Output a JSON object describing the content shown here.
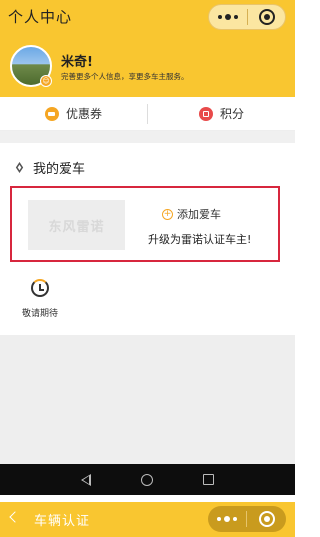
{
  "header": {
    "title": "个人中心",
    "background_color": "#F9C630",
    "menu_icon": "more-dots-icon",
    "close_icon": "target-close-icon"
  },
  "profile": {
    "name": "米奇!",
    "tip": "完善更多个人信息，享更多车主服务。",
    "avatar_icon": "avatar-landscape-image"
  },
  "tabs": [
    {
      "label": "优惠券",
      "icon": "coupon-icon",
      "color": "#F5A623"
    },
    {
      "label": "积分",
      "icon": "points-icon",
      "color": "#E84A4A"
    }
  ],
  "my_car": {
    "title": "我的爱车",
    "placeholder_brand": "东风雷诺",
    "add_label": "添加爱车",
    "upgrade_text": "升级为雷诺认证车主!",
    "highlight_color": "#D7263D"
  },
  "coming_soon": {
    "label": "敬请期待",
    "icon": "clock-icon"
  },
  "android_nav": {
    "back_icon": "back-triangle-icon",
    "home_icon": "home-circle-icon",
    "recent_icon": "recent-square-icon"
  },
  "cert_bar": {
    "title": "车辆认证",
    "back_icon": "chevron-left-icon"
  }
}
